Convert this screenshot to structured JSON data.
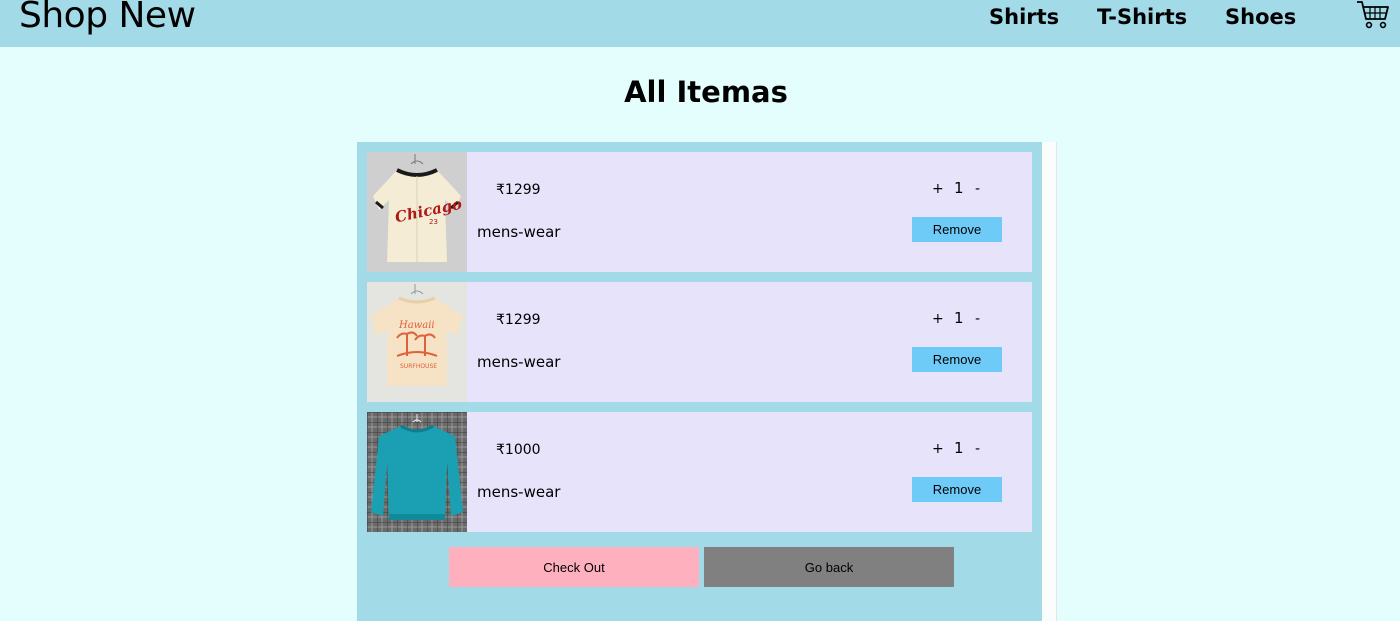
{
  "header": {
    "brand": "Shop New",
    "nav": [
      "Shirts",
      "T-Shirts",
      "Shoes"
    ],
    "cart_icon": "shopping-cart-icon"
  },
  "page_title": "All Itemas",
  "cart": {
    "items": [
      {
        "price": "₹1299",
        "category": "mens-wear",
        "quantity": "1",
        "plus": "+",
        "minus": "-",
        "remove_label": "Remove",
        "image": "cream-chicago-baseball-jersey"
      },
      {
        "price": "₹1299",
        "category": "mens-wear",
        "quantity": "1",
        "plus": "+",
        "minus": "-",
        "remove_label": "Remove",
        "image": "peach-hawaii-graphic-tshirt"
      },
      {
        "price": "₹1000",
        "category": "mens-wear",
        "quantity": "1",
        "plus": "+",
        "minus": "-",
        "remove_label": "Remove",
        "image": "teal-sweatshirt"
      }
    ],
    "checkout_label": "Check Out",
    "goback_label": "Go back"
  },
  "colors": {
    "background": "#e3fefd",
    "navbar": "#a2dae8",
    "item_card": "#e7e3fb",
    "remove_button": "#6ecbf8",
    "checkout_button": "#ffb0bf",
    "goback_button": "#808080"
  }
}
